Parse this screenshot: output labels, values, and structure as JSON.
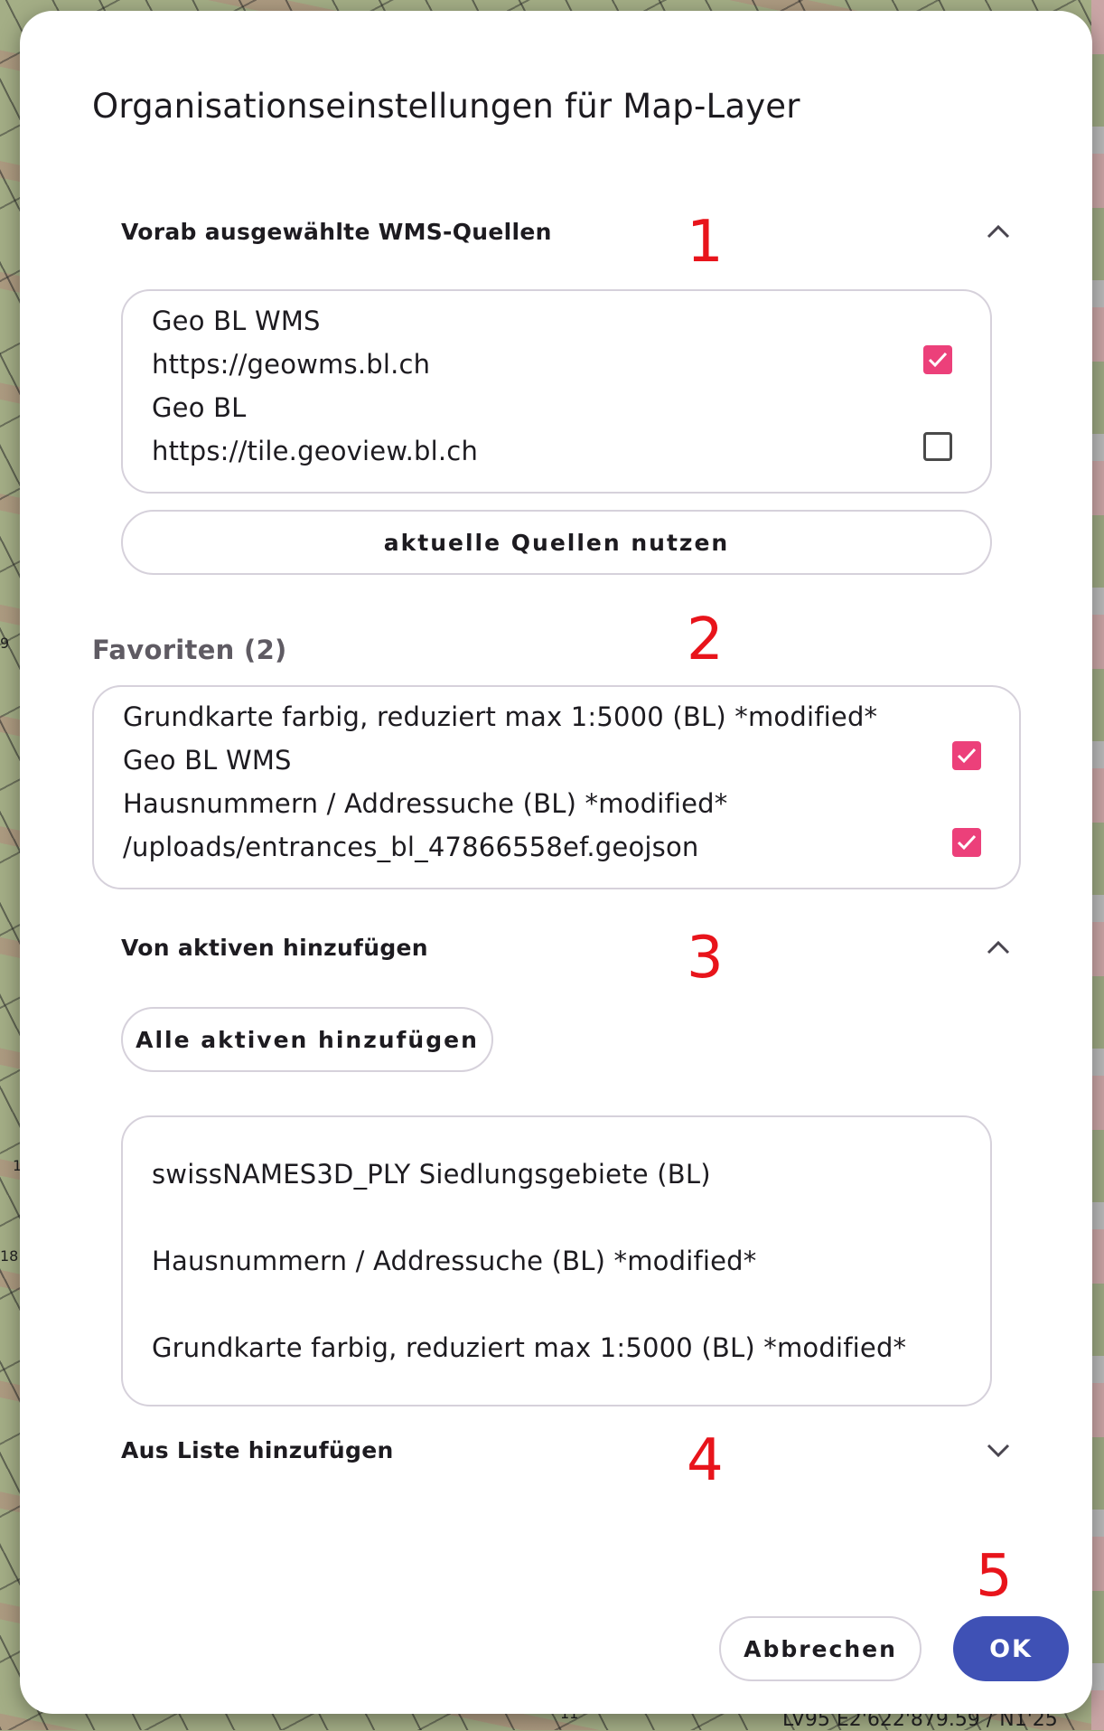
{
  "map": {
    "coords": "LV95 E2'622'879.59 / N1'25",
    "labels": [
      "9",
      "18",
      "1",
      "11"
    ]
  },
  "dialog": {
    "title": "Organisationseinstellungen für Map-Layer",
    "markers": [
      "1",
      "2",
      "3",
      "4",
      "5"
    ],
    "wms_section": {
      "title": "Vorab ausgewählte WMS-Quellen",
      "expanded": true,
      "chevron_icon": "chevron-up-icon",
      "sources": [
        {
          "name": "Geo BL WMS",
          "url": "https://geowms.bl.ch",
          "checked": true
        },
        {
          "name": "Geo BL",
          "url": "https://tile.geoview.bl.ch",
          "checked": false
        }
      ],
      "use_current_button": "aktuelle Quellen nutzen"
    },
    "favorites": {
      "title": "Favoriten (2)",
      "items": [
        {
          "name": "Grundkarte farbig, reduziert max 1:5000 (BL) *modified*",
          "source": "Geo BL WMS",
          "checked": true
        },
        {
          "name": "Hausnummern / Addressuche (BL) *modified*",
          "source": "/uploads/entrances_bl_47866558ef.geojson",
          "checked": true
        }
      ]
    },
    "active_section": {
      "title": "Von aktiven hinzufügen",
      "expanded": true,
      "chevron_icon": "chevron-up-icon",
      "add_all_button": "Alle aktiven hinzufügen",
      "items": [
        "swissNAMES3D_PLY Siedlungsgebiete (BL)",
        "Hausnummern / Addressuche (BL) *modified*",
        "Grundkarte farbig, reduziert max 1:5000 (BL) *modified*"
      ]
    },
    "list_section": {
      "title": "Aus Liste hinzufügen",
      "expanded": false,
      "chevron_icon": "chevron-down-icon"
    },
    "actions": {
      "cancel": "Abbrechen",
      "ok": "OK"
    }
  },
  "colors": {
    "checkbox_checked": "#ec407a",
    "primary_button": "#3f51b5",
    "marker": "#e8141b"
  }
}
